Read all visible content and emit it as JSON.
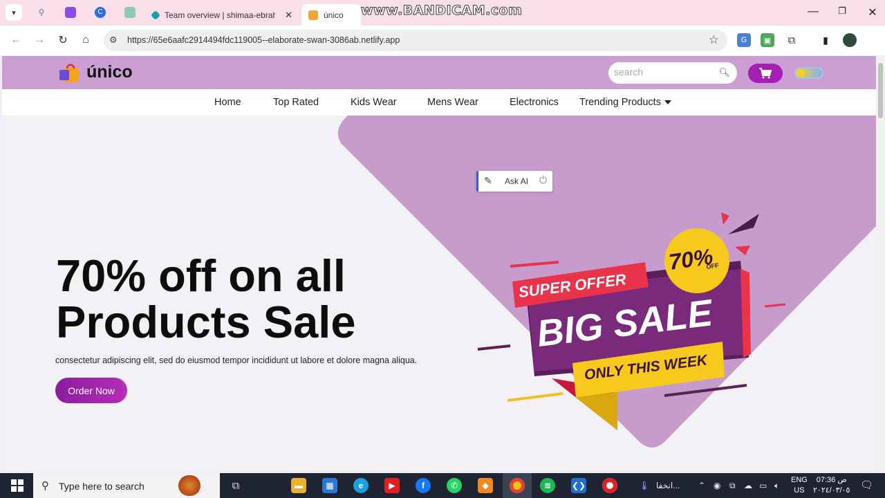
{
  "browser": {
    "tabs": [
      {
        "title": "Team overview | shimaa-ebrahi",
        "close": ""
      },
      {
        "title": "único",
        "close": "✕"
      }
    ],
    "watermark": "www.BANDICAM.com",
    "window_controls": [
      "—",
      "❐",
      "✕"
    ],
    "url": "https://65e6aafc2914494fdc119005--elaborate-swan-3086ab.netlify.app"
  },
  "site": {
    "brand": "único",
    "search_placeholder": "search",
    "nav": [
      "Home",
      "Top Rated",
      "Kids Wear",
      "Mens Wear",
      "Electronics",
      "Trending Products"
    ],
    "hero": {
      "title_line1": "70% off on all",
      "title_line2": "Products Sale",
      "description": "consectetur adipiscing elit, sed do eiusmod tempor incididunt ut labore et dolore magna aliqua.",
      "cta": "Order Now"
    },
    "askai_label": "Ask AI",
    "banner": {
      "super_offer": "SUPER OFFER",
      "big_sale": "BIG SALE",
      "only_this_week": "ONLY THIS WEEK",
      "badge_pct": "70%",
      "badge_off": "OFF"
    }
  },
  "taskbar": {
    "search_placeholder": "Type here to search",
    "tray_text": "انخفا...",
    "lang_top": "ENG",
    "lang_bottom": "US",
    "time": "07:36 ص",
    "date": "٢٠٢٤/٠٣/٠٥"
  },
  "colors": {
    "header_bg": "#cc9fd4",
    "accent_purple": "#a51fb3",
    "tabbar_bg": "#f8dfe9"
  }
}
